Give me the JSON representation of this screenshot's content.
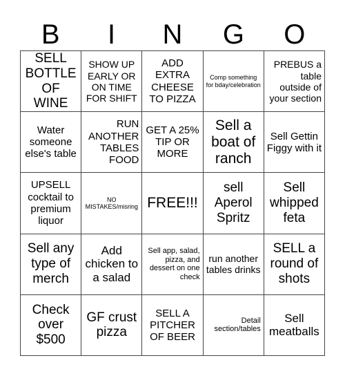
{
  "header": {
    "letters": [
      "B",
      "I",
      "N",
      "G",
      "O"
    ]
  },
  "board": {
    "rows": [
      [
        {
          "text": "SELL BOTTLE OF WINE"
        },
        {
          "text": "SHOW UP EARLY OR ON TIME FOR SHIFT"
        },
        {
          "text": "ADD EXTRA CHEESE TO PIZZA"
        },
        {
          "text": "Comp something for bday/celebration"
        },
        {
          "text": "PREBUS a table outside of your section"
        }
      ],
      [
        {
          "text": "Water someone else's table"
        },
        {
          "text": "RUN ANOTHER TABLES FOOD"
        },
        {
          "text": "GET A 25% TIP OR MORE"
        },
        {
          "text": "Sell a boat of ranch"
        },
        {
          "text": "Sell Gettin Figgy with it"
        }
      ],
      [
        {
          "text": "UPSELL cocktail to premium liquor"
        },
        {
          "text": "NO MISTAKES/misring"
        },
        {
          "text": "FREE!!!"
        },
        {
          "text": "sell Aperol Spritz"
        },
        {
          "text": "Sell whipped feta"
        }
      ],
      [
        {
          "text": "Sell any type of merch"
        },
        {
          "text": "Add chicken to a salad"
        },
        {
          "text": "Sell app, salad, pizza, and dessert on one check"
        },
        {
          "text": "run another tables drinks"
        },
        {
          "text": "SELL a round of shots"
        }
      ],
      [
        {
          "text": "Check over $500"
        },
        {
          "text": "GF crust pizza"
        },
        {
          "text": "SELL A PITCHER OF BEER"
        },
        {
          "text": "Detail section/tables"
        },
        {
          "text": "Sell meatballs"
        }
      ]
    ]
  }
}
